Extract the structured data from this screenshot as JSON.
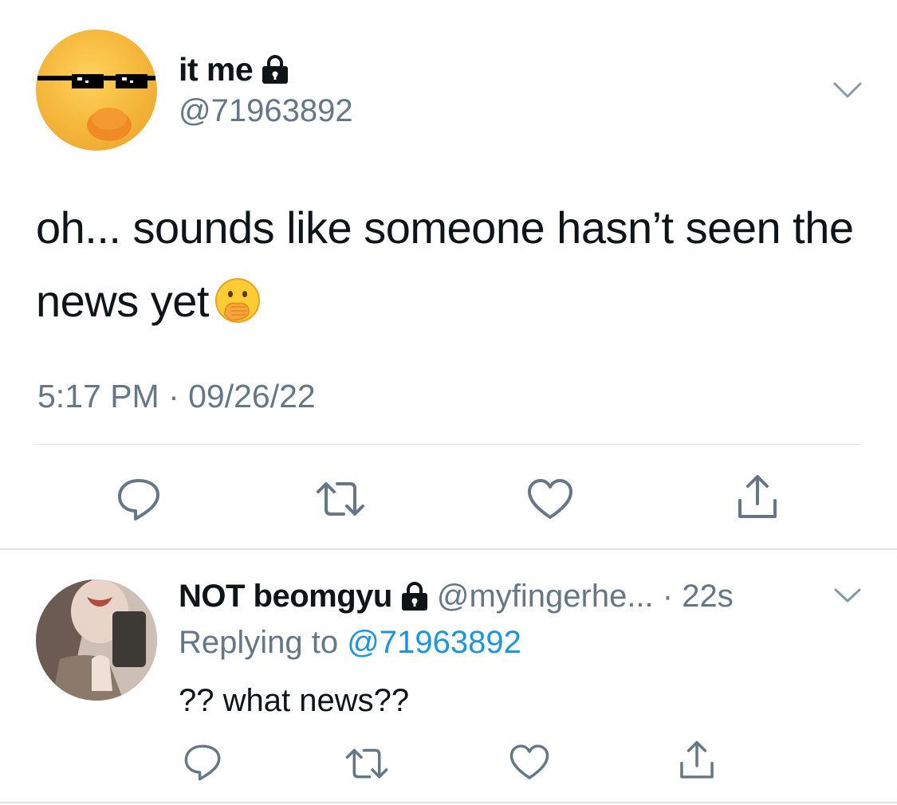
{
  "main_tweet": {
    "display_name": "it me",
    "handle": "@71963892",
    "text": "oh... sounds like someone hasn’t seen the news yet",
    "emoji": "hand-over-mouth-emoji",
    "timestamp": "5:17 PM · 09/26/22",
    "actions": [
      "reply-icon",
      "retweet-icon",
      "like-icon",
      "share-icon"
    ]
  },
  "reply_tweet": {
    "display_name": "NOT beomgyu",
    "handle_meta": "@myfingerhe... · 22s",
    "replying_prefix": "Replying to ",
    "replying_to": "@71963892",
    "text": "?? what news??",
    "actions": [
      "reply-icon",
      "retweet-icon",
      "like-icon",
      "share-icon"
    ]
  },
  "colors": {
    "secondary_text": "#657786",
    "link": "#1b95e0",
    "divider": "#dfe3e6",
    "icon": "#657786"
  }
}
